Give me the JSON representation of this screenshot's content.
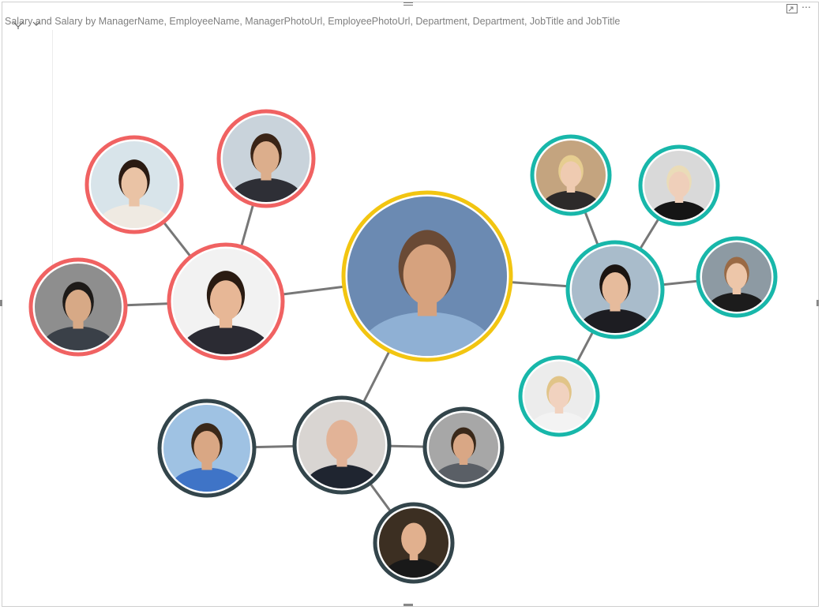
{
  "visual": {
    "title": "Salary and Salary by ManagerName, EmployeeName, ManagerPhotoUrl, EmployeePhotoUrl, Department, Department, JobTitle and JobTitle"
  },
  "toolbar_icons": [
    "focus-mode-icon",
    "more-options-icon",
    "filter-icon",
    "chevron-down-icon"
  ],
  "colors": {
    "ceo_ring": "#f2c511",
    "dept_red": "#f06262",
    "dept_teal": "#18b7aa",
    "dept_dark": "#33454b",
    "link": "#777777"
  },
  "org_graph": {
    "nodes": [
      {
        "id": "ceo",
        "group": "ceo",
        "role": "manager",
        "photo": {
          "bg": "#6b8ab2",
          "skin": "#d6a27e",
          "hair": "#6a4a35",
          "shirt": "#8fb0d4"
        }
      },
      {
        "id": "red-manager",
        "group": "red",
        "role": "manager",
        "photo": {
          "bg": "#f2f2f2",
          "skin": "#e7b796",
          "hair": "#2a1b12",
          "shirt": "#2b2b33"
        }
      },
      {
        "id": "red-emp-woman",
        "group": "red",
        "role": "employee",
        "photo": {
          "bg": "#d8e4ea",
          "skin": "#eac3a5",
          "hair": "#2a1a12",
          "shirt": "#efeae2"
        }
      },
      {
        "id": "red-emp-man-top",
        "group": "red",
        "role": "employee",
        "photo": {
          "bg": "#c9d3db",
          "skin": "#dcae8c",
          "hair": "#3a2416",
          "shirt": "#2e2f36"
        }
      },
      {
        "id": "red-emp-man-left",
        "group": "red",
        "role": "employee",
        "photo": {
          "bg": "#8e8e8e",
          "skin": "#d7a986",
          "hair": "#1d1a18",
          "shirt": "#3a4048"
        }
      },
      {
        "id": "teal-manager",
        "group": "teal",
        "role": "manager",
        "photo": {
          "bg": "#a9bccb",
          "skin": "#e6bb9c",
          "hair": "#1b1411",
          "shirt": "#1d1d22"
        }
      },
      {
        "id": "teal-emp-1",
        "group": "teal",
        "role": "employee",
        "photo": {
          "bg": "#c4a47f",
          "skin": "#efcbb1",
          "hair": "#e6cd90",
          "shirt": "#2d2a2a"
        }
      },
      {
        "id": "teal-emp-2",
        "group": "teal",
        "role": "employee",
        "photo": {
          "bg": "#d9d9d9",
          "skin": "#efcfba",
          "hair": "#eadcb8",
          "shirt": "#151515"
        }
      },
      {
        "id": "teal-emp-3",
        "group": "teal",
        "role": "employee",
        "photo": {
          "bg": "#8d9aa3",
          "skin": "#edc6a9",
          "hair": "#9a6a45",
          "shirt": "#1c1c1c"
        }
      },
      {
        "id": "teal-emp-4",
        "group": "teal",
        "role": "employee",
        "photo": {
          "bg": "#ececec",
          "skin": "#f1d2bf",
          "hair": "#e1c488",
          "shirt": "#f3f3f3"
        }
      },
      {
        "id": "dark-manager",
        "group": "dark",
        "role": "manager",
        "photo": {
          "bg": "#d9d5d2",
          "skin": "#e2b397",
          "hair": "#e2b397",
          "shirt": "#1f2530"
        }
      },
      {
        "id": "dark-emp-left",
        "group": "dark",
        "role": "employee",
        "photo": {
          "bg": "#9fc2e3",
          "skin": "#d9a784",
          "hair": "#3a2819",
          "shirt": "#3f74c7"
        }
      },
      {
        "id": "dark-emp-right",
        "group": "dark",
        "role": "employee",
        "photo": {
          "bg": "#a7a7a7",
          "skin": "#d9a785",
          "hair": "#3a2819",
          "shirt": "#5a5f66"
        }
      },
      {
        "id": "dark-emp-bottom",
        "group": "dark",
        "role": "employee",
        "photo": {
          "bg": "#3c2f22",
          "skin": "#e1b08e",
          "hair": "#e1b08e",
          "shirt": "#191919"
        }
      }
    ],
    "links": [
      [
        "ceo",
        "red-manager"
      ],
      [
        "ceo",
        "teal-manager"
      ],
      [
        "ceo",
        "dark-manager"
      ],
      [
        "red-manager",
        "red-emp-woman"
      ],
      [
        "red-manager",
        "red-emp-man-top"
      ],
      [
        "red-manager",
        "red-emp-man-left"
      ],
      [
        "teal-manager",
        "teal-emp-1"
      ],
      [
        "teal-manager",
        "teal-emp-2"
      ],
      [
        "teal-manager",
        "teal-emp-3"
      ],
      [
        "teal-manager",
        "teal-emp-4"
      ],
      [
        "dark-manager",
        "dark-emp-left"
      ],
      [
        "dark-manager",
        "dark-emp-right"
      ],
      [
        "dark-manager",
        "dark-emp-bottom"
      ]
    ]
  }
}
